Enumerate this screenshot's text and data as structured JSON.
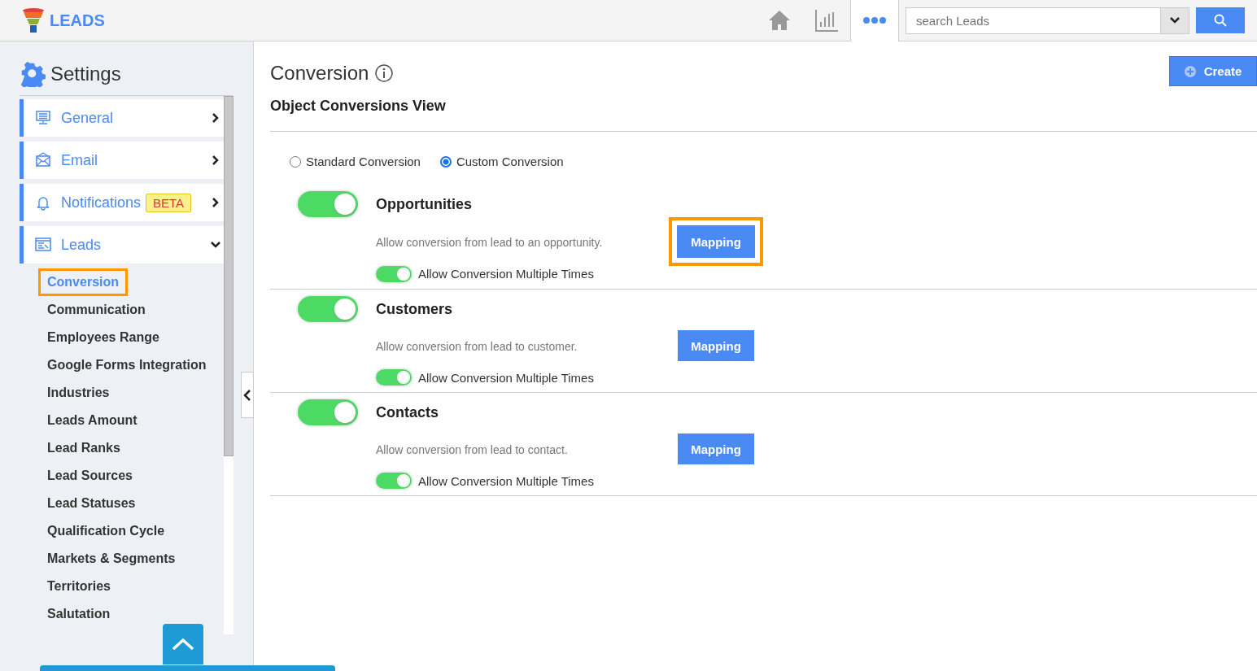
{
  "brand": {
    "name": "LEADS"
  },
  "search": {
    "placeholder": "search Leads"
  },
  "sidebar": {
    "title": "Settings",
    "items": [
      {
        "label": "General",
        "expanded": false
      },
      {
        "label": "Email",
        "expanded": false
      },
      {
        "label": "Notifications",
        "badge": "BETA",
        "expanded": false
      },
      {
        "label": "Leads",
        "expanded": true,
        "children": [
          {
            "label": "Conversion",
            "selected": true,
            "highlighted": true
          },
          {
            "label": "Communication",
            "selected": false,
            "highlighted": false
          },
          {
            "label": "Employees Range",
            "selected": false,
            "highlighted": false
          },
          {
            "label": "Google Forms Integration",
            "selected": false,
            "highlighted": false
          },
          {
            "label": "Industries",
            "selected": false,
            "highlighted": false
          },
          {
            "label": "Leads Amount",
            "selected": false,
            "highlighted": false
          },
          {
            "label": "Lead Ranks",
            "selected": false,
            "highlighted": false
          },
          {
            "label": "Lead Sources",
            "selected": false,
            "highlighted": false
          },
          {
            "label": "Lead Statuses",
            "selected": false,
            "highlighted": false
          },
          {
            "label": "Qualification Cycle",
            "selected": false,
            "highlighted": false
          },
          {
            "label": "Markets & Segments",
            "selected": false,
            "highlighted": false
          },
          {
            "label": "Territories",
            "selected": false,
            "highlighted": false
          },
          {
            "label": "Salutation",
            "selected": false,
            "highlighted": false
          }
        ]
      }
    ]
  },
  "page": {
    "title": "Conversion",
    "subtitle": "Object Conversions View",
    "create_button": "Create",
    "conversion_types": [
      {
        "label": "Standard Conversion",
        "selected": false
      },
      {
        "label": "Custom Conversion",
        "selected": true
      }
    ],
    "objects": [
      {
        "name": "Opportunities",
        "on": true,
        "description": "Allow conversion from lead to an opportunity.",
        "mapping_button": "Mapping",
        "highlighted": true,
        "multiple": {
          "label": "Allow Conversion Multiple Times",
          "on": true
        }
      },
      {
        "name": "Customers",
        "on": true,
        "description": "Allow conversion from lead to customer.",
        "mapping_button": "Mapping",
        "highlighted": false,
        "multiple": {
          "label": "Allow Conversion Multiple Times",
          "on": true
        }
      },
      {
        "name": "Contacts",
        "on": true,
        "description": "Allow conversion from lead to contact.",
        "mapping_button": "Mapping",
        "highlighted": false,
        "multiple": {
          "label": "Allow Conversion Multiple Times",
          "on": true
        }
      }
    ]
  }
}
